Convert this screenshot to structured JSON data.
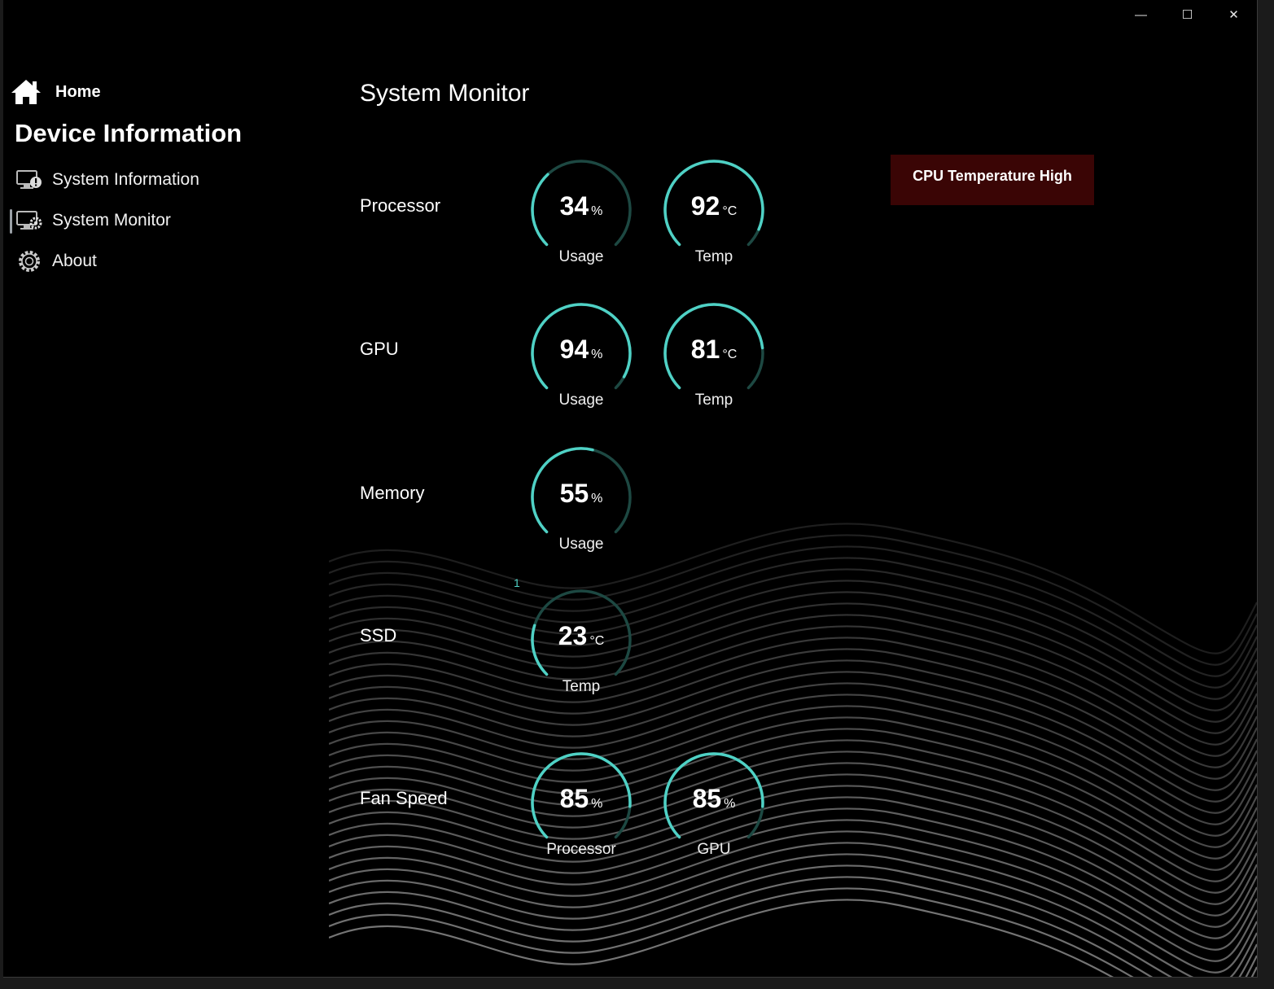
{
  "window_controls": {
    "minimize": "—",
    "maximize": "☐",
    "close": "✕"
  },
  "nav": {
    "home": {
      "label": "Home",
      "icon": "home-icon"
    },
    "section_title": "Device Information",
    "items": [
      {
        "label": "System Information",
        "icon": "monitor-info-icon",
        "selected": false
      },
      {
        "label": "System Monitor",
        "icon": "monitor-gear-icon",
        "selected": true
      },
      {
        "label": "About",
        "icon": "gear-icon",
        "selected": false
      }
    ]
  },
  "page": {
    "title": "System Monitor"
  },
  "alert": {
    "text": "CPU Temperature High",
    "color": "#3a0505"
  },
  "accent_color": "#4fd1c5",
  "track_color": "#1d4842",
  "rows": {
    "processor": {
      "label": "Processor",
      "usage": {
        "value": "34",
        "unit": "%",
        "caption": "Usage",
        "level": 0.34
      },
      "temp": {
        "value": "92",
        "unit": "°C",
        "caption": "Temp",
        "level": 0.92
      }
    },
    "gpu": {
      "label": "GPU",
      "usage": {
        "value": "94",
        "unit": "%",
        "caption": "Usage",
        "level": 0.94
      },
      "temp": {
        "value": "81",
        "unit": "°C",
        "caption": "Temp",
        "level": 0.81
      }
    },
    "memory": {
      "label": "Memory",
      "usage": {
        "value": "55",
        "unit": "%",
        "caption": "Usage",
        "level": 0.55
      }
    },
    "ssd": {
      "label": "SSD",
      "index": "1",
      "temp": {
        "value": "23",
        "unit": "°C",
        "caption": "Temp",
        "level": 0.23
      }
    },
    "fan": {
      "label": "Fan Speed",
      "processor": {
        "value": "85",
        "unit": "%",
        "caption": "Processor",
        "level": 0.85
      },
      "gpu": {
        "value": "85",
        "unit": "%",
        "caption": "GPU",
        "level": 0.85
      }
    }
  }
}
